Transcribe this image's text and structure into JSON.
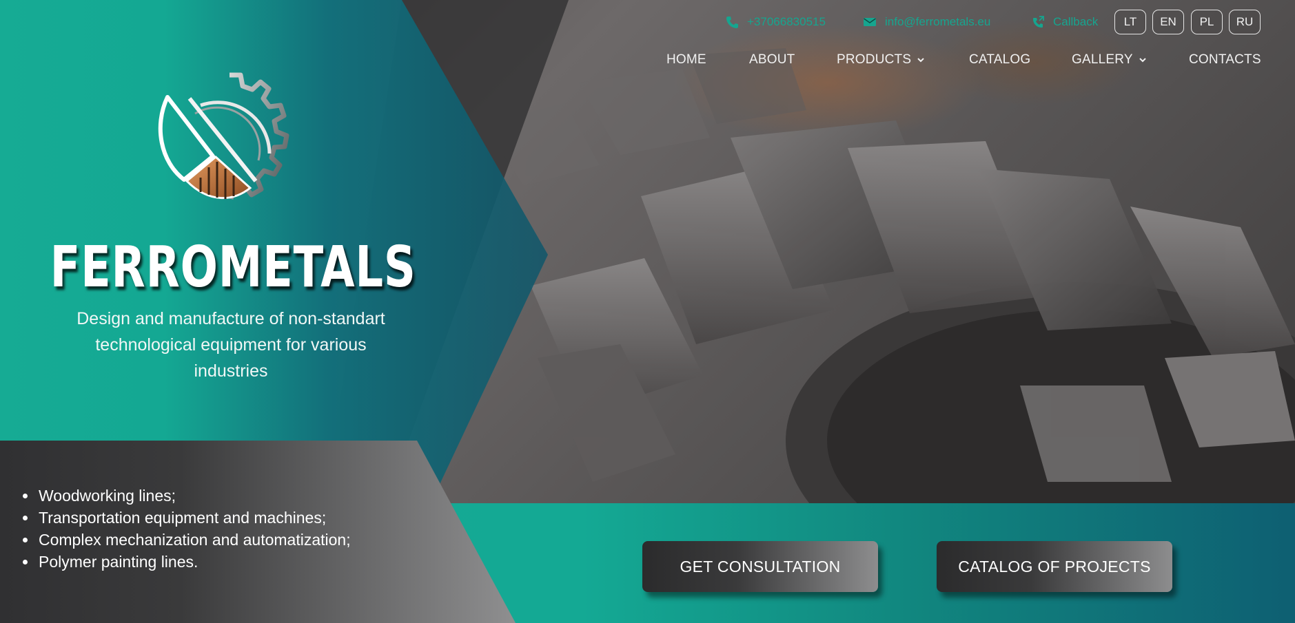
{
  "contact": {
    "phone": "+37066830515",
    "email": "info@ferrometals.eu",
    "callback": "Callback"
  },
  "languages": [
    "LT",
    "EN",
    "PL",
    "RU"
  ],
  "nav": {
    "home": "HOME",
    "about": "ABOUT",
    "products": "PRODUCTS",
    "catalog": "CATALOG",
    "gallery": "GALLERY",
    "contacts": "CONTACTS"
  },
  "brand": {
    "name": "FERROMETALS",
    "tagline": "Design and manufacture of non-standart technological equipment for various industries"
  },
  "features": [
    "Woodworking lines;",
    "Transportation equipment and machines;",
    "Complex mechanization and automatization;",
    "Polymer painting lines."
  ],
  "buttons": {
    "consultation": "GET CONSULTATION",
    "catalog_projects": "CATALOG OF PROJECTS"
  },
  "colors": {
    "teal": "#16a993",
    "dark_teal": "#0e5f72",
    "accent_contact": "#16a58f",
    "dark_grey": "#2f2f30",
    "copper": "#c8733c"
  },
  "icons": {
    "phone": "phone-icon",
    "email": "envelope-icon",
    "callback": "callback-phone-icon",
    "dropdown": "chevron-down-icon",
    "logo": "gear-logo-icon"
  }
}
